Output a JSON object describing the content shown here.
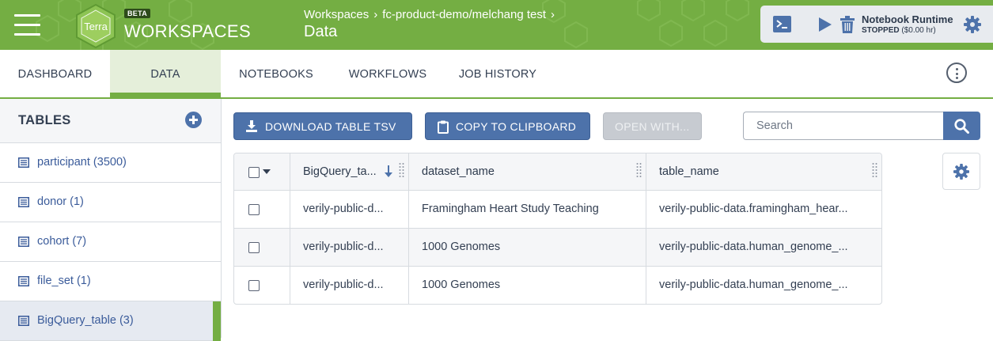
{
  "header": {
    "logo_text": "Terra",
    "beta_badge": "BETA",
    "app_title": "WORKSPACES",
    "breadcrumb": [
      "Workspaces",
      "fc-product-demo/melchang test"
    ],
    "page_title": "Data",
    "header_color": "#74ae43"
  },
  "runtime": {
    "title": "Notebook Runtime",
    "status": "STOPPED",
    "cost": "($0.00 hr)"
  },
  "tabs": [
    {
      "label": "DASHBOARD",
      "active": false
    },
    {
      "label": "DATA",
      "active": true
    },
    {
      "label": "NOTEBOOKS",
      "active": false
    },
    {
      "label": "WORKFLOWS",
      "active": false
    },
    {
      "label": "JOB HISTORY",
      "active": false
    }
  ],
  "sidebar": {
    "heading": "TABLES",
    "items": [
      {
        "label": "participant (3500)",
        "active": false
      },
      {
        "label": "donor (1)",
        "active": false
      },
      {
        "label": "cohort (7)",
        "active": false
      },
      {
        "label": "file_set (1)",
        "active": false
      },
      {
        "label": "BigQuery_table (3)",
        "active": true
      }
    ]
  },
  "toolbar": {
    "download_label": "DOWNLOAD TABLE TSV",
    "copy_label": "COPY TO CLIPBOARD",
    "open_with_label": "OPEN WITH...",
    "search_placeholder": "Search"
  },
  "table": {
    "columns": [
      "BigQuery_ta...",
      "dataset_name",
      "table_name"
    ],
    "rows": [
      [
        "verily-public-d...",
        "Framingham Heart Study Teaching",
        "verily-public-data.framingham_hear..."
      ],
      [
        "verily-public-d...",
        "1000 Genomes",
        "verily-public-data.human_genome_..."
      ],
      [
        "verily-public-d...",
        "1000 Genomes",
        "verily-public-data.human_genome_..."
      ]
    ]
  },
  "colors": {
    "accent_green": "#74ae43",
    "primary_blue": "#4d72aa",
    "link_blue": "#3a5b9a",
    "text_dark": "#333f52"
  },
  "icons": {
    "menu": "hamburger-icon",
    "terminal": "terminal-icon",
    "play": "play-icon",
    "trash": "trash-icon",
    "gear": "gear-icon",
    "kebab": "more-vertical-icon",
    "add": "plus-circle-icon",
    "table": "table-list-icon",
    "download": "download-icon",
    "clipboard": "clipboard-icon",
    "search": "search-icon",
    "sort": "sort-down-arrow-icon",
    "resize": "column-resize-grip-icon"
  }
}
